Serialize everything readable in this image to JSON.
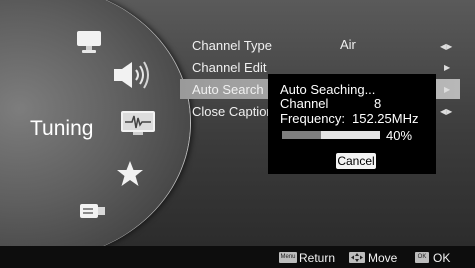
{
  "sidebar": {
    "category_label": "Tuning",
    "icons": [
      "monitor-icon",
      "speaker-icon",
      "tuning-icon",
      "star-icon",
      "connector-icon"
    ]
  },
  "menu": {
    "items": [
      {
        "label": "Channel Type",
        "value": "Air"
      },
      {
        "label": "Channel Edit",
        "value": ""
      },
      {
        "label": "Auto Search",
        "value": ""
      },
      {
        "label": "Close Caption",
        "value": ""
      }
    ]
  },
  "dialog": {
    "title": "Auto Seaching...",
    "channel_label": "Channel",
    "channel_value": "8",
    "frequency_label": "Frequency:",
    "frequency_value": "152.25MHz",
    "progress_percent": 40,
    "progress_text": "40%",
    "cancel_label": "Cancel"
  },
  "footer": {
    "return_badge": "Menu",
    "return_label": "Return",
    "move_label": "Move",
    "ok_badge": "OK",
    "ok_label": "OK"
  },
  "colors": {
    "highlight": "#a8a8a8",
    "dialog_bg": "#000000",
    "progress_fill": "#7f7f7f"
  }
}
